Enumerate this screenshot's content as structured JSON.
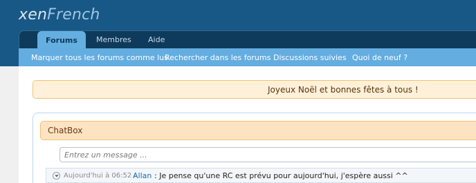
{
  "site": {
    "logo_part1": "xen",
    "logo_part2": "French"
  },
  "nav": {
    "tabs": [
      {
        "label": "Forums",
        "active": true
      },
      {
        "label": "Membres",
        "active": false
      },
      {
        "label": "Aide",
        "active": false
      }
    ]
  },
  "subnav": {
    "links": [
      "Marquer tous les forums comme lus",
      "Rechercher dans les forums",
      "Discussions suivies",
      "Quoi de neuf ?"
    ]
  },
  "notice": {
    "text": "Joyeux Noël et bonnes fêtes à tous !"
  },
  "chatbox": {
    "title": "ChatBox",
    "input_placeholder": "Entrez un message ...",
    "messages": [
      {
        "time": "Aujourd'hui à 06:52 -",
        "user": "Allan",
        "text": ": Je pense qu'une RC est prévu pour aujourd'hui, j'espère aussi ^^"
      }
    ]
  },
  "colors": {
    "header_bg": "#185886",
    "navbar_bg": "#0e3b5c",
    "active_tab": "#65aee0",
    "subnav_bg": "#64ade0",
    "notice_bg": "#fff1d9",
    "chat_head_bg": "#fde3c2",
    "link_blue": "#1f6eb5"
  }
}
